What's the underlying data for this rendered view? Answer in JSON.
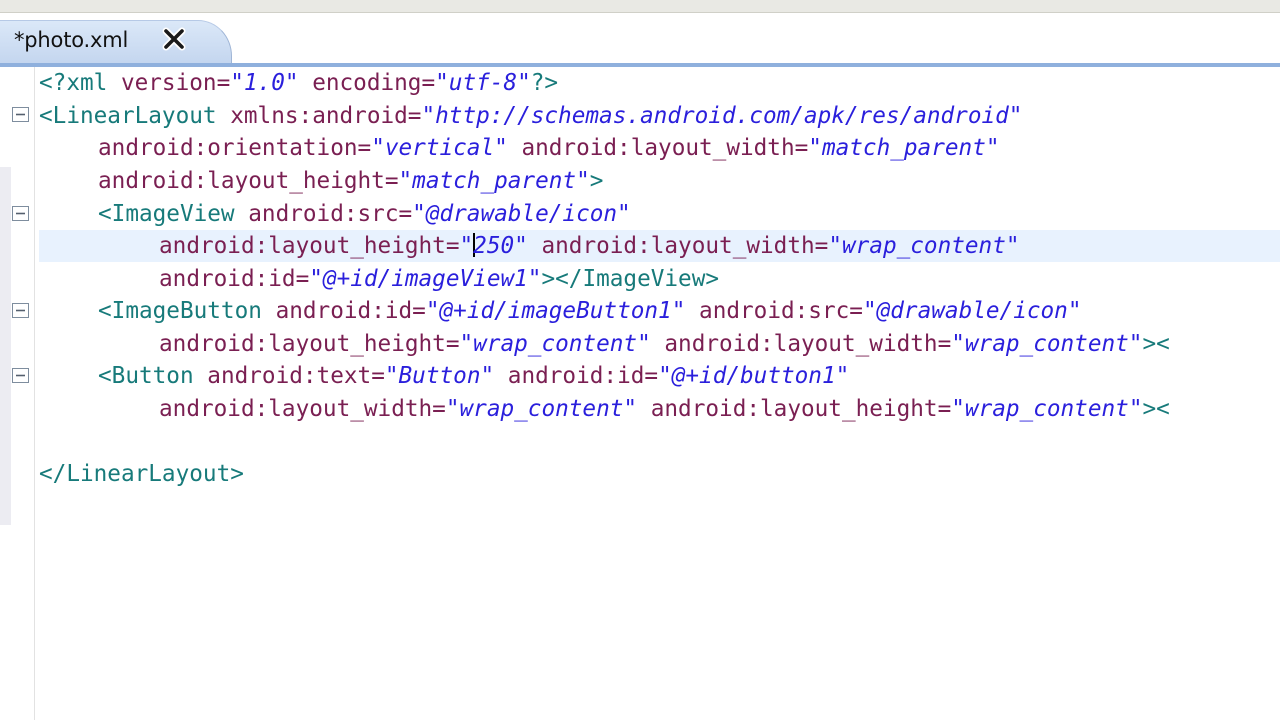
{
  "editor": {
    "tab_title": "*photo.xml",
    "tab_close_icon": "close-icon",
    "colors": {
      "tag": "#177a7a",
      "attribute": "#7a1f52",
      "value": "#2a1fdc",
      "tab": "#c4d6ef",
      "current_line": "#e8f2fe"
    }
  },
  "code": {
    "l1": {
      "open": "<?xml",
      "a1": " version=",
      "v1": "\"1.0\"",
      "a2": " encoding=",
      "v2": "\"utf-8\"",
      "close": "?>"
    },
    "l2": {
      "open": "<LinearLayout",
      "a1": " xmlns:android=",
      "v1": "\"http://schemas.android.com/apk/res/android\""
    },
    "l3": {
      "a1": "android:orientation=",
      "v1": "\"vertical\"",
      "a2": " android:layout_width=",
      "v2": "\"match_parent\""
    },
    "l4": {
      "a1": "android:layout_height=",
      "v1": "\"match_parent\"",
      "close": ">"
    },
    "l5": {
      "open": "<ImageView",
      "a1": " android:src=",
      "v1": "\"@drawable/icon\""
    },
    "l6": {
      "a1": "android:layout_height=",
      "v1_before_caret": "\"",
      "v1_after_caret": "250\"",
      "a2": " android:layout_width=",
      "v2": "\"wrap_content\""
    },
    "l7": {
      "a1": "android:id=",
      "v1": "\"@+id/imageView1\"",
      "close": "></ImageView>"
    },
    "l8": {
      "open": "<ImageButton",
      "a1": " android:id=",
      "v1": "\"@+id/imageButton1\"",
      "a2": " android:src=",
      "v2": "\"@drawable/icon\""
    },
    "l9": {
      "a1": "android:layout_height=",
      "v1": "\"wrap_content\"",
      "a2": " android:layout_width=",
      "v2": "\"wrap_content\"",
      "close": "><"
    },
    "l10": {
      "open": "<Button",
      "a1": " android:text=",
      "v1": "\"Button\"",
      "a2": " android:id=",
      "v2": "\"@+id/button1\""
    },
    "l11": {
      "a1": "android:layout_width=",
      "v1": "\"wrap_content\"",
      "a2": " android:layout_height=",
      "v2": "\"wrap_content\"",
      "close": "><"
    },
    "l12": {
      "close": "</LinearLayout>"
    }
  }
}
